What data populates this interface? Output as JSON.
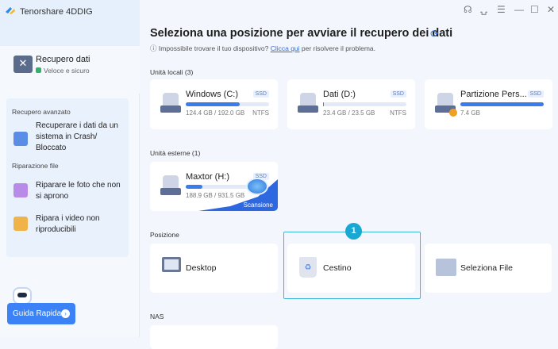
{
  "app": {
    "title": "Tenorshare 4DDIG"
  },
  "window_controls": [
    {
      "name": "headset-icon",
      "glyph": "☊"
    },
    {
      "name": "feedback-icon",
      "glyph": "⍽"
    },
    {
      "name": "menu-icon",
      "glyph": "☰"
    },
    {
      "name": "minimize-icon",
      "glyph": "—"
    },
    {
      "name": "maximize-icon",
      "glyph": "☐"
    },
    {
      "name": "close-icon",
      "glyph": "✕"
    }
  ],
  "sidebar": {
    "recovery": {
      "title": "Recupero dati",
      "subtitle": "Veloce e sicuro"
    },
    "advanced_heading": "Recupero avanzato",
    "crash_item": "Recuperare i dati da un sistema in Crash/ Bloccato",
    "repair_heading": "Riparazione file",
    "photo_item": "Riparare le foto che non si aprono",
    "video_item": "Ripara i video non riproducibili",
    "guide_button": "Guida Rapida"
  },
  "main": {
    "title": "Seleziona una posizione per avviare il recupero dei dati",
    "hint_prefix": "Impossibile trovare il tuo dispositivo?",
    "hint_link": "Clicca qui",
    "hint_suffix": "per risolvere il problema.",
    "local_heading": "Unità locali (3)",
    "local_drives": [
      {
        "name": "Windows (C:)",
        "type": "SSD",
        "size": "124.4 GB / 192.0 GB",
        "fs": "NTFS",
        "used": 0.65
      },
      {
        "name": "Dati (D:)",
        "type": "SSD",
        "size": "23.4 GB / 23.5 GB",
        "fs": "NTFS",
        "used": 0.01
      },
      {
        "name": "Partizione Pers...",
        "type": "SSD",
        "size": "7.4 GB",
        "fs": "",
        "used": 1.0
      }
    ],
    "external_heading": "Unità esterne (1)",
    "external_drives": [
      {
        "name": "Maxtor (H:)",
        "type": "SSD",
        "size": "188.9 GB / 931.5 GB",
        "used": 0.2,
        "scan_label": "Scansione"
      }
    ],
    "position_heading": "Posizione",
    "positions": [
      "Desktop",
      "Cestino",
      "Seleziona File"
    ],
    "step_badge": "1",
    "nas_heading": "NAS"
  }
}
